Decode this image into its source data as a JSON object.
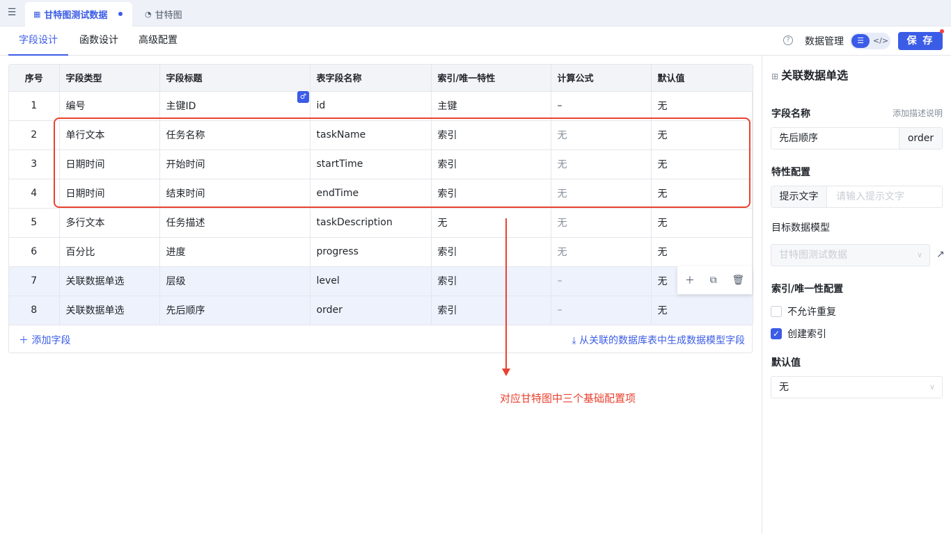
{
  "tabs": [
    {
      "label": "甘特图测试数据",
      "icon": "table-icon",
      "active": true
    },
    {
      "label": "甘特图",
      "icon": "chart-icon",
      "active": false
    }
  ],
  "subtabs": [
    "字段设计",
    "函数设计",
    "高级配置"
  ],
  "toolbar": {
    "data_manage": "数据管理",
    "save": "保 存"
  },
  "table": {
    "headers": [
      "序号",
      "字段类型",
      "字段标题",
      "表字段名称",
      "索引/唯一特性",
      "计算公式",
      "默认值"
    ],
    "rows": [
      [
        "1",
        "编号",
        "主键ID",
        "id",
        "主键",
        "–",
        "无"
      ],
      [
        "2",
        "单行文本",
        "任务名称",
        "taskName",
        "索引",
        "无",
        "无"
      ],
      [
        "3",
        "日期时间",
        "开始时间",
        "startTime",
        "索引",
        "无",
        "无"
      ],
      [
        "4",
        "日期时间",
        "结束时间",
        "endTime",
        "索引",
        "无",
        "无"
      ],
      [
        "5",
        "多行文本",
        "任务描述",
        "taskDescription",
        "无",
        "无",
        "无"
      ],
      [
        "6",
        "百分比",
        "进度",
        "progress",
        "索引",
        "无",
        "无"
      ],
      [
        "7",
        "关联数据单选",
        "层级",
        "level",
        "索引",
        "–",
        "无"
      ],
      [
        "8",
        "关联数据单选",
        "先后顺序",
        "order",
        "索引",
        "–",
        "无"
      ]
    ],
    "add_field": "添加字段",
    "generate": "从关联的数据库表中生成数据模型字段"
  },
  "annotation": "对应甘特图中三个基础配置项",
  "panel": {
    "title": "关联数据单选",
    "field_name_label": "字段名称",
    "add_desc": "添加描述说明",
    "field_title": "先后顺序",
    "field_key": "order",
    "feature_label": "特性配置",
    "hint_label": "提示文字",
    "hint_placeholder": "请输入提示文字",
    "model_label": "目标数据模型",
    "model_value": "甘特图测试数据",
    "index_label": "索引/唯一性配置",
    "no_dup": "不允许重复",
    "create_index": "创建索引",
    "default_label": "默认值",
    "default_value": "无"
  }
}
